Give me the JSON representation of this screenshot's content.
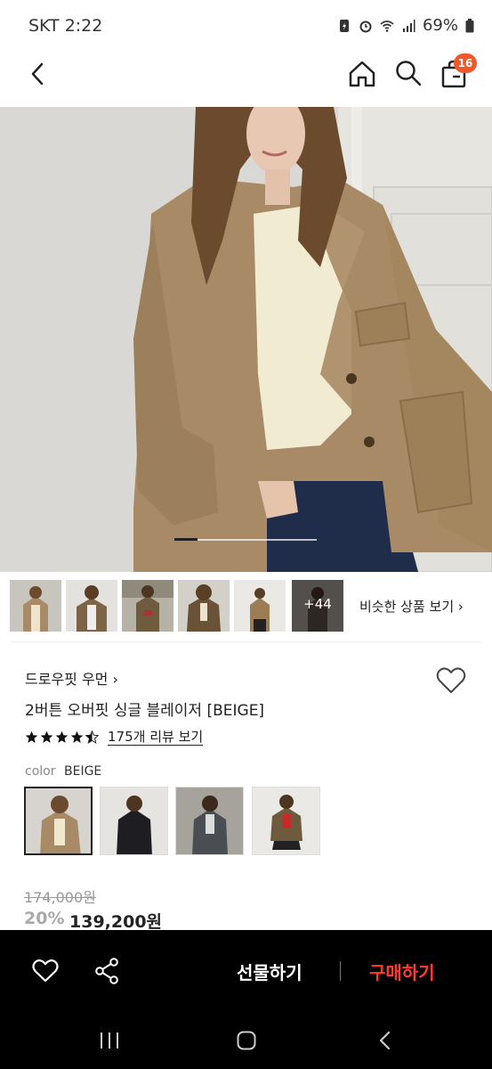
{
  "status_bar": {
    "carrier_time": "SKT 2:22",
    "battery": "69%"
  },
  "header": {
    "cart_count": "16"
  },
  "gallery": {
    "more_count": "+44",
    "similar_link": "비슷한 상품 보기 ›"
  },
  "product": {
    "brand": "드로우핏 우먼 ›",
    "name": "2버튼 오버핏 싱글 블레이저 [BEIGE]",
    "rating_stars": 4.5,
    "review_link": "175개 리뷰 보기",
    "color_label": "color",
    "color_value": "BEIGE",
    "original_price": "174,000원",
    "discount": "20%",
    "price": "139,200원"
  },
  "actions": {
    "gift_label": "선물하기",
    "buy_label": "구매하기"
  },
  "colors": {
    "accent": "#f05a28",
    "buy": "#ff3b2f"
  }
}
